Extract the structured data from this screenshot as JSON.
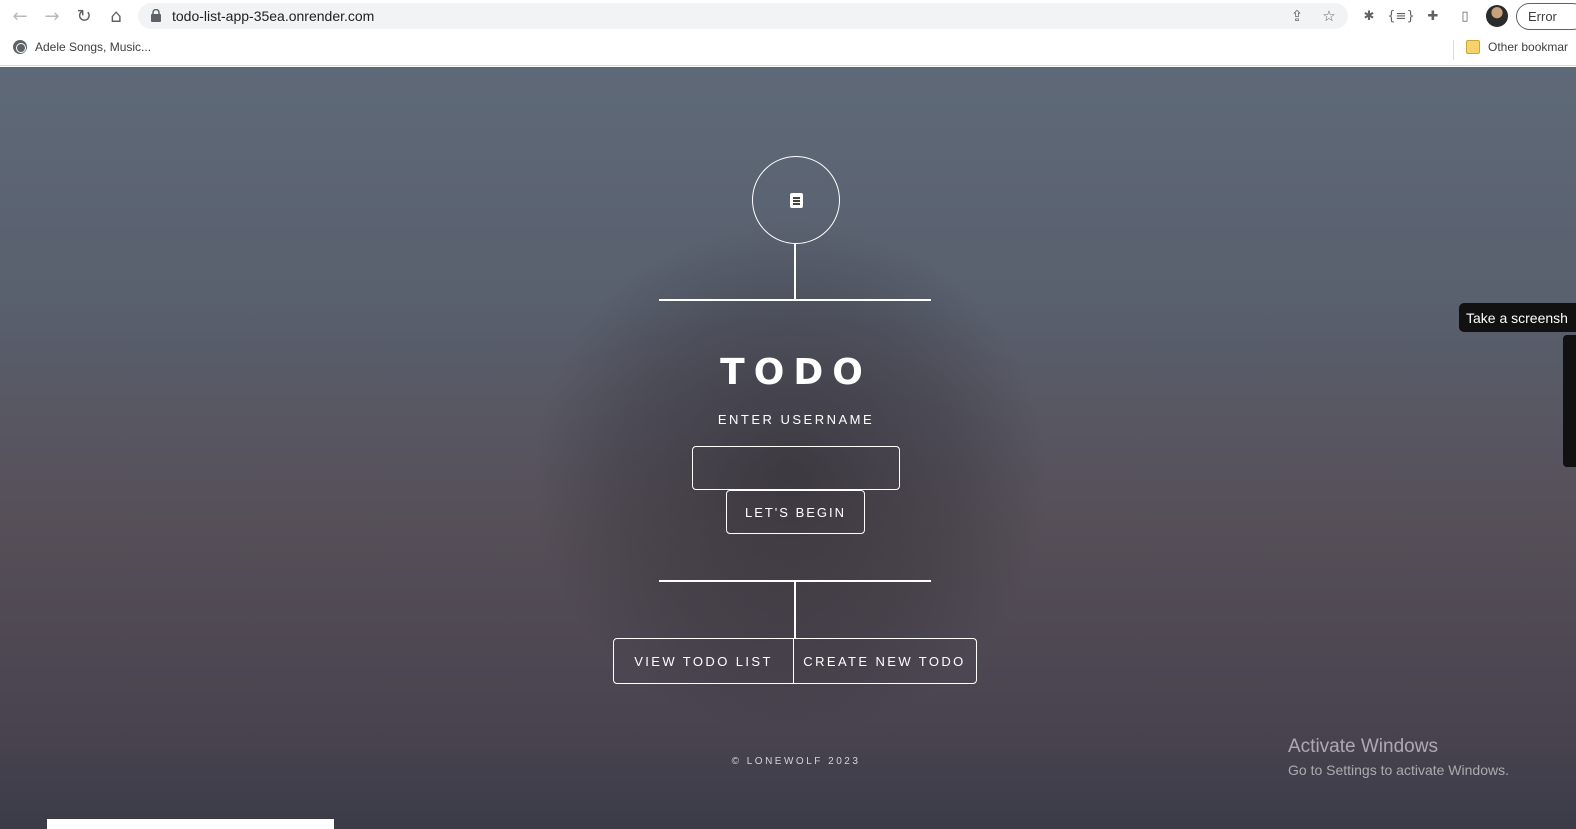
{
  "browser": {
    "url": "todo-list-app-35ea.onrender.com",
    "profile_chip": "Error",
    "bookmarks": [
      {
        "label": "Adele Songs, Music...",
        "icon": "globe-icon"
      },
      {
        "label": "Other bookmar",
        "icon": "folder-icon"
      }
    ]
  },
  "app": {
    "logo_icon": "document-icon",
    "title": "TODO",
    "subtitle": "ENTER USERNAME",
    "username_value": "",
    "begin_label": "LET'S BEGIN",
    "nav": {
      "view_label": "VIEW TODO LIST",
      "create_label": "CREATE NEW TODO"
    },
    "footer": "© LONEWOLF 2023"
  },
  "overlay": {
    "activate_title": "Activate Windows",
    "activate_sub": "Go to Settings to activate Windows.",
    "tooltip": "Take a screensh"
  }
}
